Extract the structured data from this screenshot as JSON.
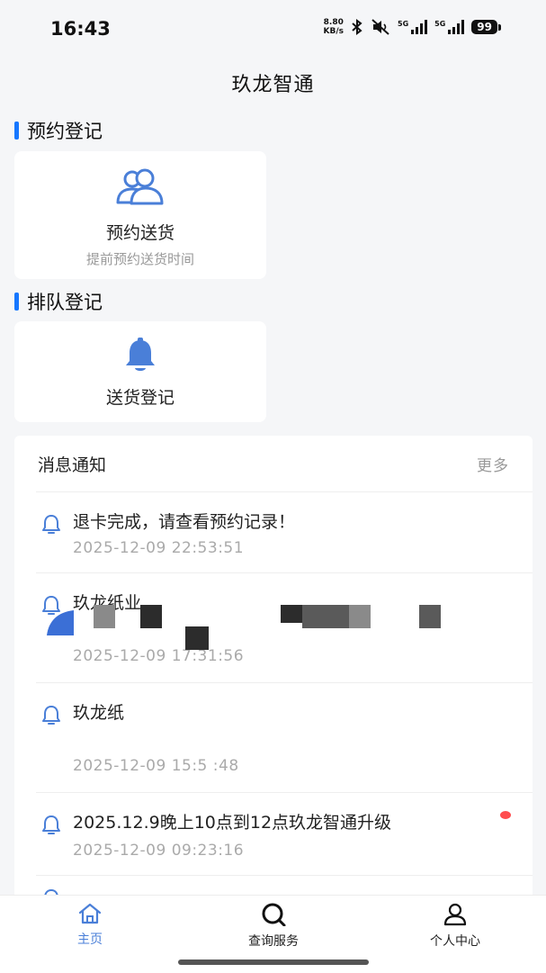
{
  "status_bar": {
    "time": "16:43",
    "net_speed_value": "8.80",
    "net_speed_unit": "KB/s",
    "sim1": "5G",
    "sim2": "5G",
    "battery": "99"
  },
  "header": {
    "title": "玖龙智通"
  },
  "sections": {
    "reservation": {
      "title": "预约登记",
      "card": {
        "icon": "users-icon",
        "title": "预约送货",
        "subtitle": "提前预约送货时间"
      }
    },
    "queue": {
      "title": "排队登记",
      "card": {
        "icon": "bell-icon",
        "title": "送货登记"
      }
    }
  },
  "notices": {
    "title": "消息通知",
    "more": "更多",
    "items": [
      {
        "text": "退卡完成，请查看预约记录！",
        "time": "2025-12-09 22:53:51"
      },
      {
        "text": "玖龙纸业",
        "time": "2025-12-09 17:31:56"
      },
      {
        "text": "玖龙纸",
        "time": "2025-12-09 15:5 :48"
      },
      {
        "text": "2025.12.9晚上10点到12点玖龙智通升级",
        "time": "2025-12-09 09:23:16",
        "unread": true
      }
    ]
  },
  "tabbar": {
    "items": [
      {
        "label": "主页",
        "icon": "home-icon",
        "active": true
      },
      {
        "label": "查询服务",
        "icon": "search-icon",
        "active": false
      },
      {
        "label": "个人中心",
        "icon": "person-icon",
        "active": false
      }
    ]
  },
  "colors": {
    "accent": "#1677ff",
    "icon_blue": "#4a7fd8",
    "unread_dot": "#ff4d4f"
  }
}
